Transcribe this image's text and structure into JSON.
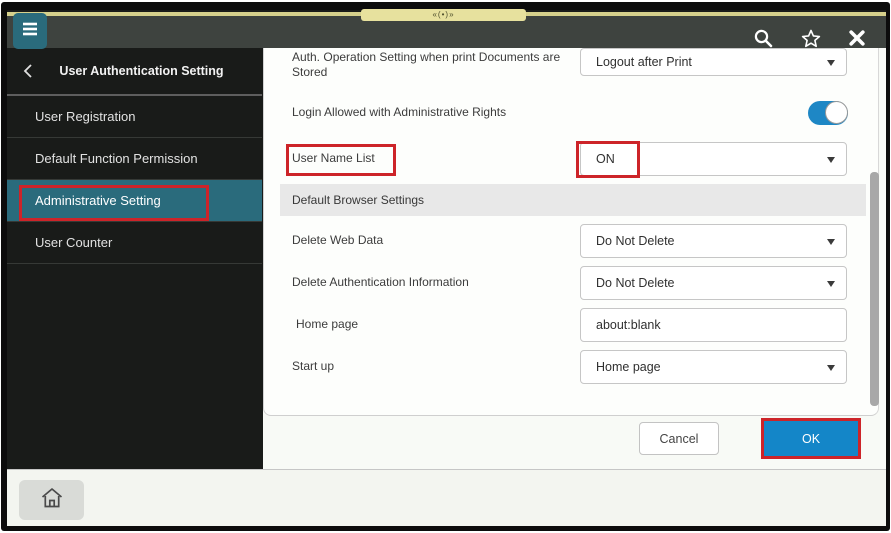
{
  "device": {
    "top_indicator_glyph": "«(•)»"
  },
  "topbar": {
    "menu_icon": "hamburger-menu",
    "search_icon": "magnifier",
    "favorite_icon": "star-outline",
    "close_icon": "close-x"
  },
  "sidebar": {
    "back_chevron": "‹",
    "title": "User Authentication Setting",
    "items": [
      {
        "label": "User Registration",
        "selected": false
      },
      {
        "label": "Default Function Permission",
        "selected": false
      },
      {
        "label": "Administrative Setting",
        "selected": true,
        "annotated": true
      },
      {
        "label": "User Counter",
        "selected": false
      }
    ]
  },
  "main": {
    "rows": [
      {
        "type": "dropdown",
        "label": "Auth. Operation Setting when print Documents are Stored",
        "value": "Logout after Print"
      },
      {
        "type": "toggle",
        "label": "Login Allowed with Administrative Rights",
        "state": "on"
      },
      {
        "type": "dropdown",
        "label": "User Name List",
        "value": "ON",
        "annotated": true
      },
      {
        "type": "section",
        "label": "Default Browser Settings"
      },
      {
        "type": "dropdown",
        "label": "Delete Web Data",
        "value": "Do Not Delete"
      },
      {
        "type": "dropdown",
        "label": "Delete Authentication Information",
        "value": "Do Not Delete"
      },
      {
        "type": "input",
        "label": "Home page",
        "value": "about:blank"
      },
      {
        "type": "dropdown",
        "label": "Start up",
        "value": "Home page"
      }
    ],
    "buttons": {
      "cancel": "Cancel",
      "ok": "OK"
    }
  },
  "footer": {
    "home_icon": "home-outline"
  },
  "annotations": {
    "color": "#cd2429",
    "highlighted_elements": [
      "Administrative Setting",
      "User Name List",
      "ON dropdown value",
      "OK button"
    ]
  },
  "colors": {
    "topbar_bg": "#3e433f",
    "sidebar_bg": "#191b19",
    "selected_teal": "#2a6b7c",
    "menu_button_teal": "#2a6b7c",
    "toggle_blue": "#1e87c5",
    "ok_blue": "#1486c8",
    "annotation_red": "#cd2429",
    "section_band_gray": "#e8e8e8",
    "device_strip_yellow": "#e7e19e"
  }
}
